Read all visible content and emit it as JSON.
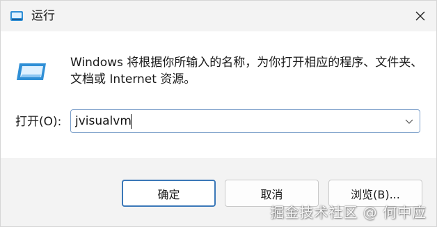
{
  "window": {
    "title": "运行",
    "close_icon": "close-icon"
  },
  "dialog": {
    "description": "Windows 将根据你所输入的名称，为你打开相应的程序、文件夹、文档或 Internet 资源。",
    "open_label": "打开(O):",
    "input_value": "jvisualvm"
  },
  "buttons": {
    "ok": "确定",
    "cancel": "取消",
    "browse": "浏览(B)..."
  },
  "watermark": {
    "text": "掘金技术社区 @ 何中应"
  },
  "colors": {
    "accent": "#3b78b8",
    "icon_blue": "#2f8fd6"
  }
}
